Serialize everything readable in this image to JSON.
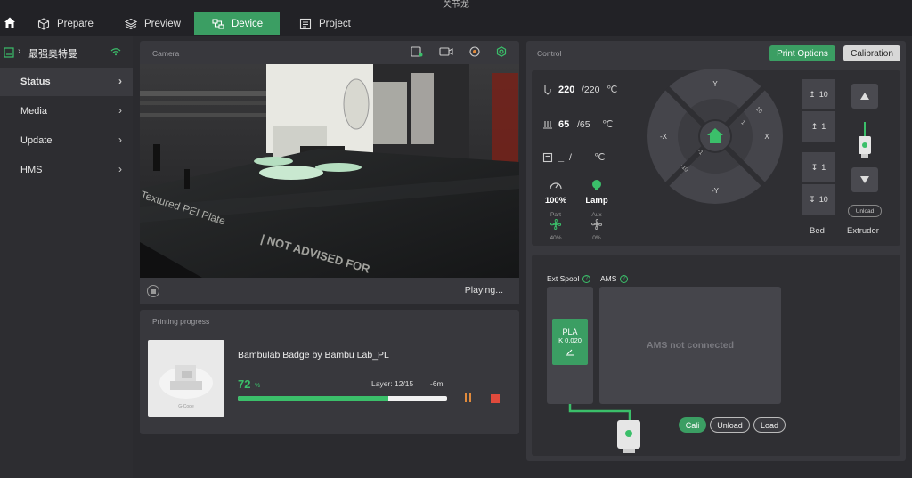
{
  "app": {
    "title": "关节龙"
  },
  "tabs": [
    {
      "label": "Prepare",
      "icon": "cube-icon"
    },
    {
      "label": "Preview",
      "icon": "layers-icon"
    },
    {
      "label": "Device",
      "icon": "device-icon"
    },
    {
      "label": "Project",
      "icon": "project-icon"
    }
  ],
  "active_tab": "Device",
  "sidebar": {
    "printer_name": "最强奥特曼",
    "items": [
      {
        "label": "Status"
      },
      {
        "label": "Media"
      },
      {
        "label": "Update"
      },
      {
        "label": "HMS"
      }
    ],
    "active_item": "Status"
  },
  "camera": {
    "title": "Camera",
    "status": "Playing..."
  },
  "progress": {
    "title": "Printing progress",
    "job_name": "Bambulab Badge by Bambu Lab_PL",
    "percent": "72",
    "percent_unit": "%",
    "percent_fraction": 0.72,
    "layer": "Layer: 12/15",
    "remaining": "-6m",
    "thumb_label": "G-Code"
  },
  "control": {
    "title": "Control",
    "print_options_label": "Print Options",
    "calibration_label": "Calibration",
    "nozzle": {
      "current": "220",
      "target": "/220",
      "unit": "℃"
    },
    "bed_temp": {
      "current": "65",
      "target": "/65",
      "unit": "℃"
    },
    "chamber": {
      "current": "_",
      "target": "/",
      "unit": "℃"
    },
    "speed": {
      "value": "100%",
      "label": ""
    },
    "lamp": {
      "label": "Lamp"
    },
    "part_fan": {
      "label": "Part",
      "value": "40%"
    },
    "aux_fan": {
      "label": "Aux",
      "value": "0%"
    },
    "jog": {
      "y_plus": "Y",
      "y_minus": "-Y",
      "x_plus": "X",
      "x_minus": "-X",
      "plus10": "10",
      "plus1": "1",
      "minus1": "-1",
      "minus10": "-10"
    },
    "bed": {
      "label": "Bed",
      "up10": "10",
      "up1": "1",
      "down1": "1",
      "down10": "10"
    },
    "extruder": {
      "label": "Extruder",
      "unload_label": "Unload"
    },
    "ams": {
      "ext_spool_label": "Ext Spool",
      "ams_label": "AMS",
      "help": "?",
      "filament_name": "PLA",
      "filament_k": "K 0.020",
      "not_connected": "AMS not connected",
      "cali_label": "Cali",
      "unload_label": "Unload",
      "load_label": "Load"
    }
  },
  "colors": {
    "accent": "#3b9e63",
    "progress_green": "#3bbf6a",
    "pause": "#e08a3c",
    "stop": "#e04a3c"
  }
}
